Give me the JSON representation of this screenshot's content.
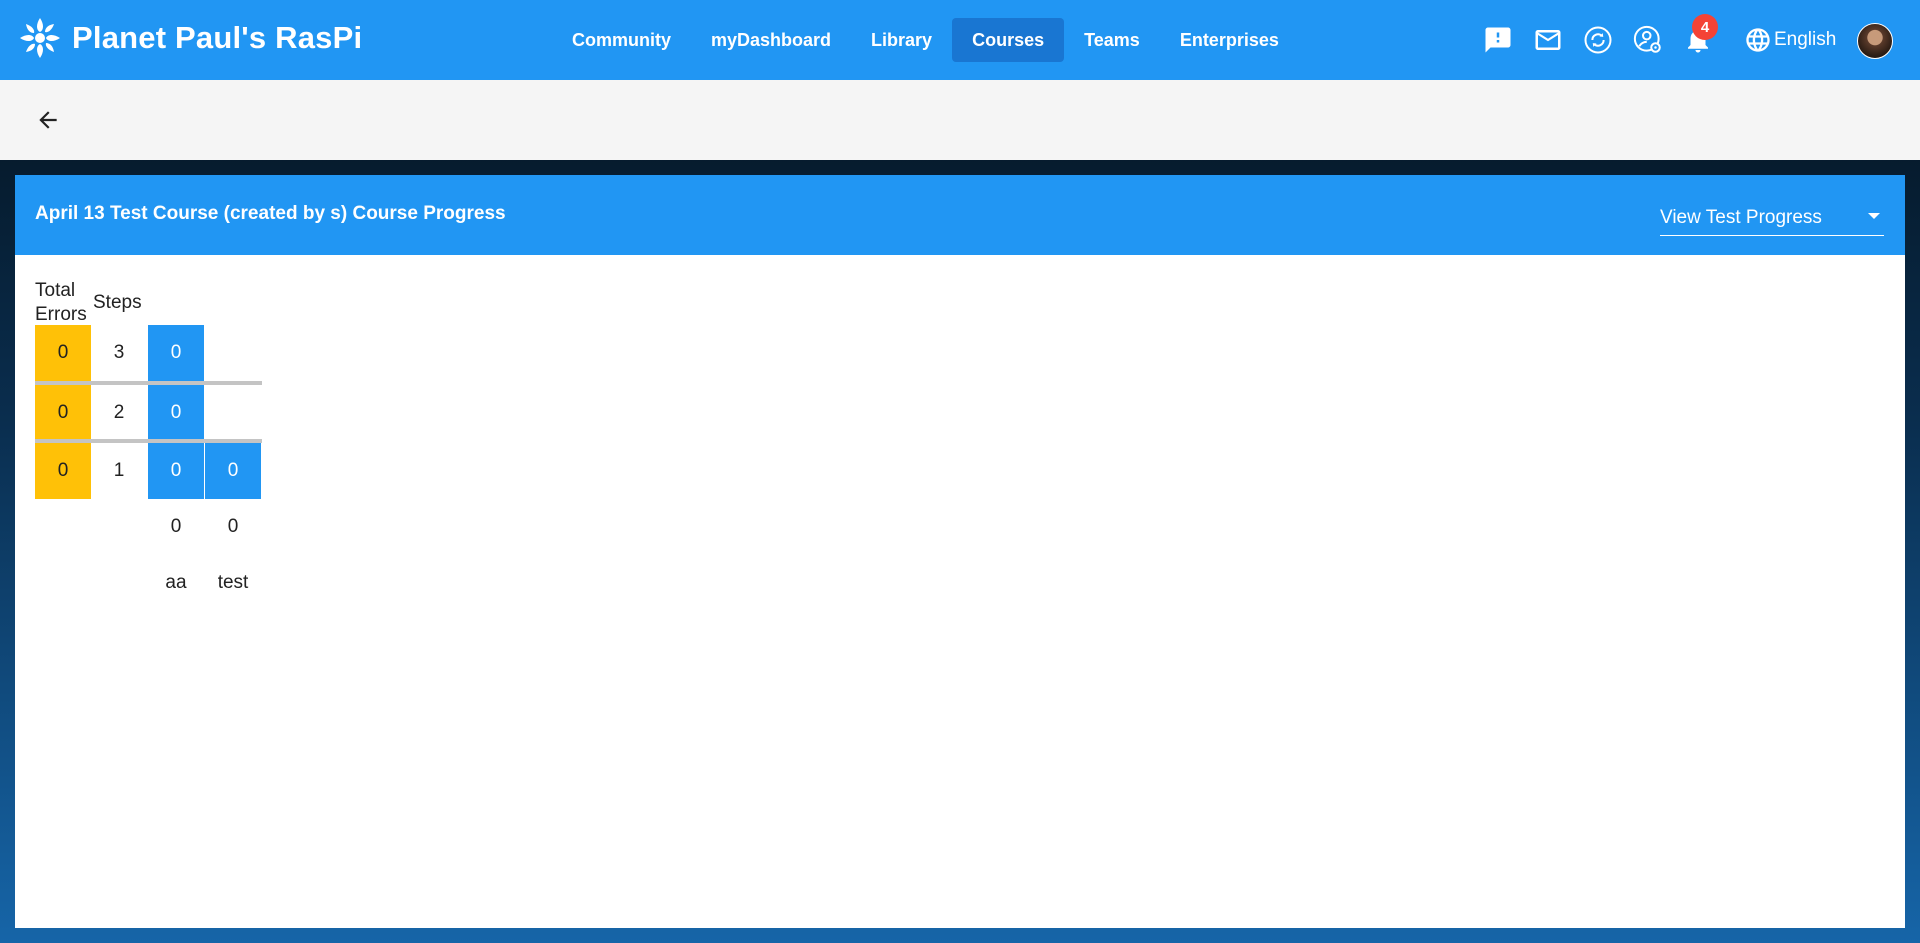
{
  "app": {
    "title": "Planet Paul's RasPi"
  },
  "nav": {
    "items": [
      {
        "label": "Community"
      },
      {
        "label": "myDashboard"
      },
      {
        "label": "Library"
      },
      {
        "label": "Courses",
        "active": true
      },
      {
        "label": "Teams"
      },
      {
        "label": "Enterprises"
      }
    ]
  },
  "header_actions": {
    "icons": [
      "feedback-icon",
      "mail-icon",
      "sync-icon",
      "manager-icon",
      "notifications-icon",
      "language-icon"
    ],
    "notification_count": "4",
    "language": "English"
  },
  "page": {
    "title": "April 13 Test Course (created by s) Course Progress",
    "view_select": {
      "value": "View Test Progress"
    }
  },
  "progress": {
    "headers": {
      "errors_line1": "Total",
      "errors_line2": "Errors",
      "steps": "Steps"
    },
    "rows": [
      {
        "total_errors": "0",
        "step": "3",
        "cells": [
          "0"
        ]
      },
      {
        "total_errors": "0",
        "step": "2",
        "cells": [
          "0"
        ]
      },
      {
        "total_errors": "0",
        "step": "1",
        "cells": [
          "0",
          "0"
        ]
      }
    ],
    "totals": [
      "0",
      "0"
    ],
    "users": [
      "aa",
      "test"
    ]
  },
  "colors": {
    "primary": "#2196f3",
    "active_nav": "#1976d2",
    "errors": "#ffc107",
    "badge": "#f44336"
  }
}
